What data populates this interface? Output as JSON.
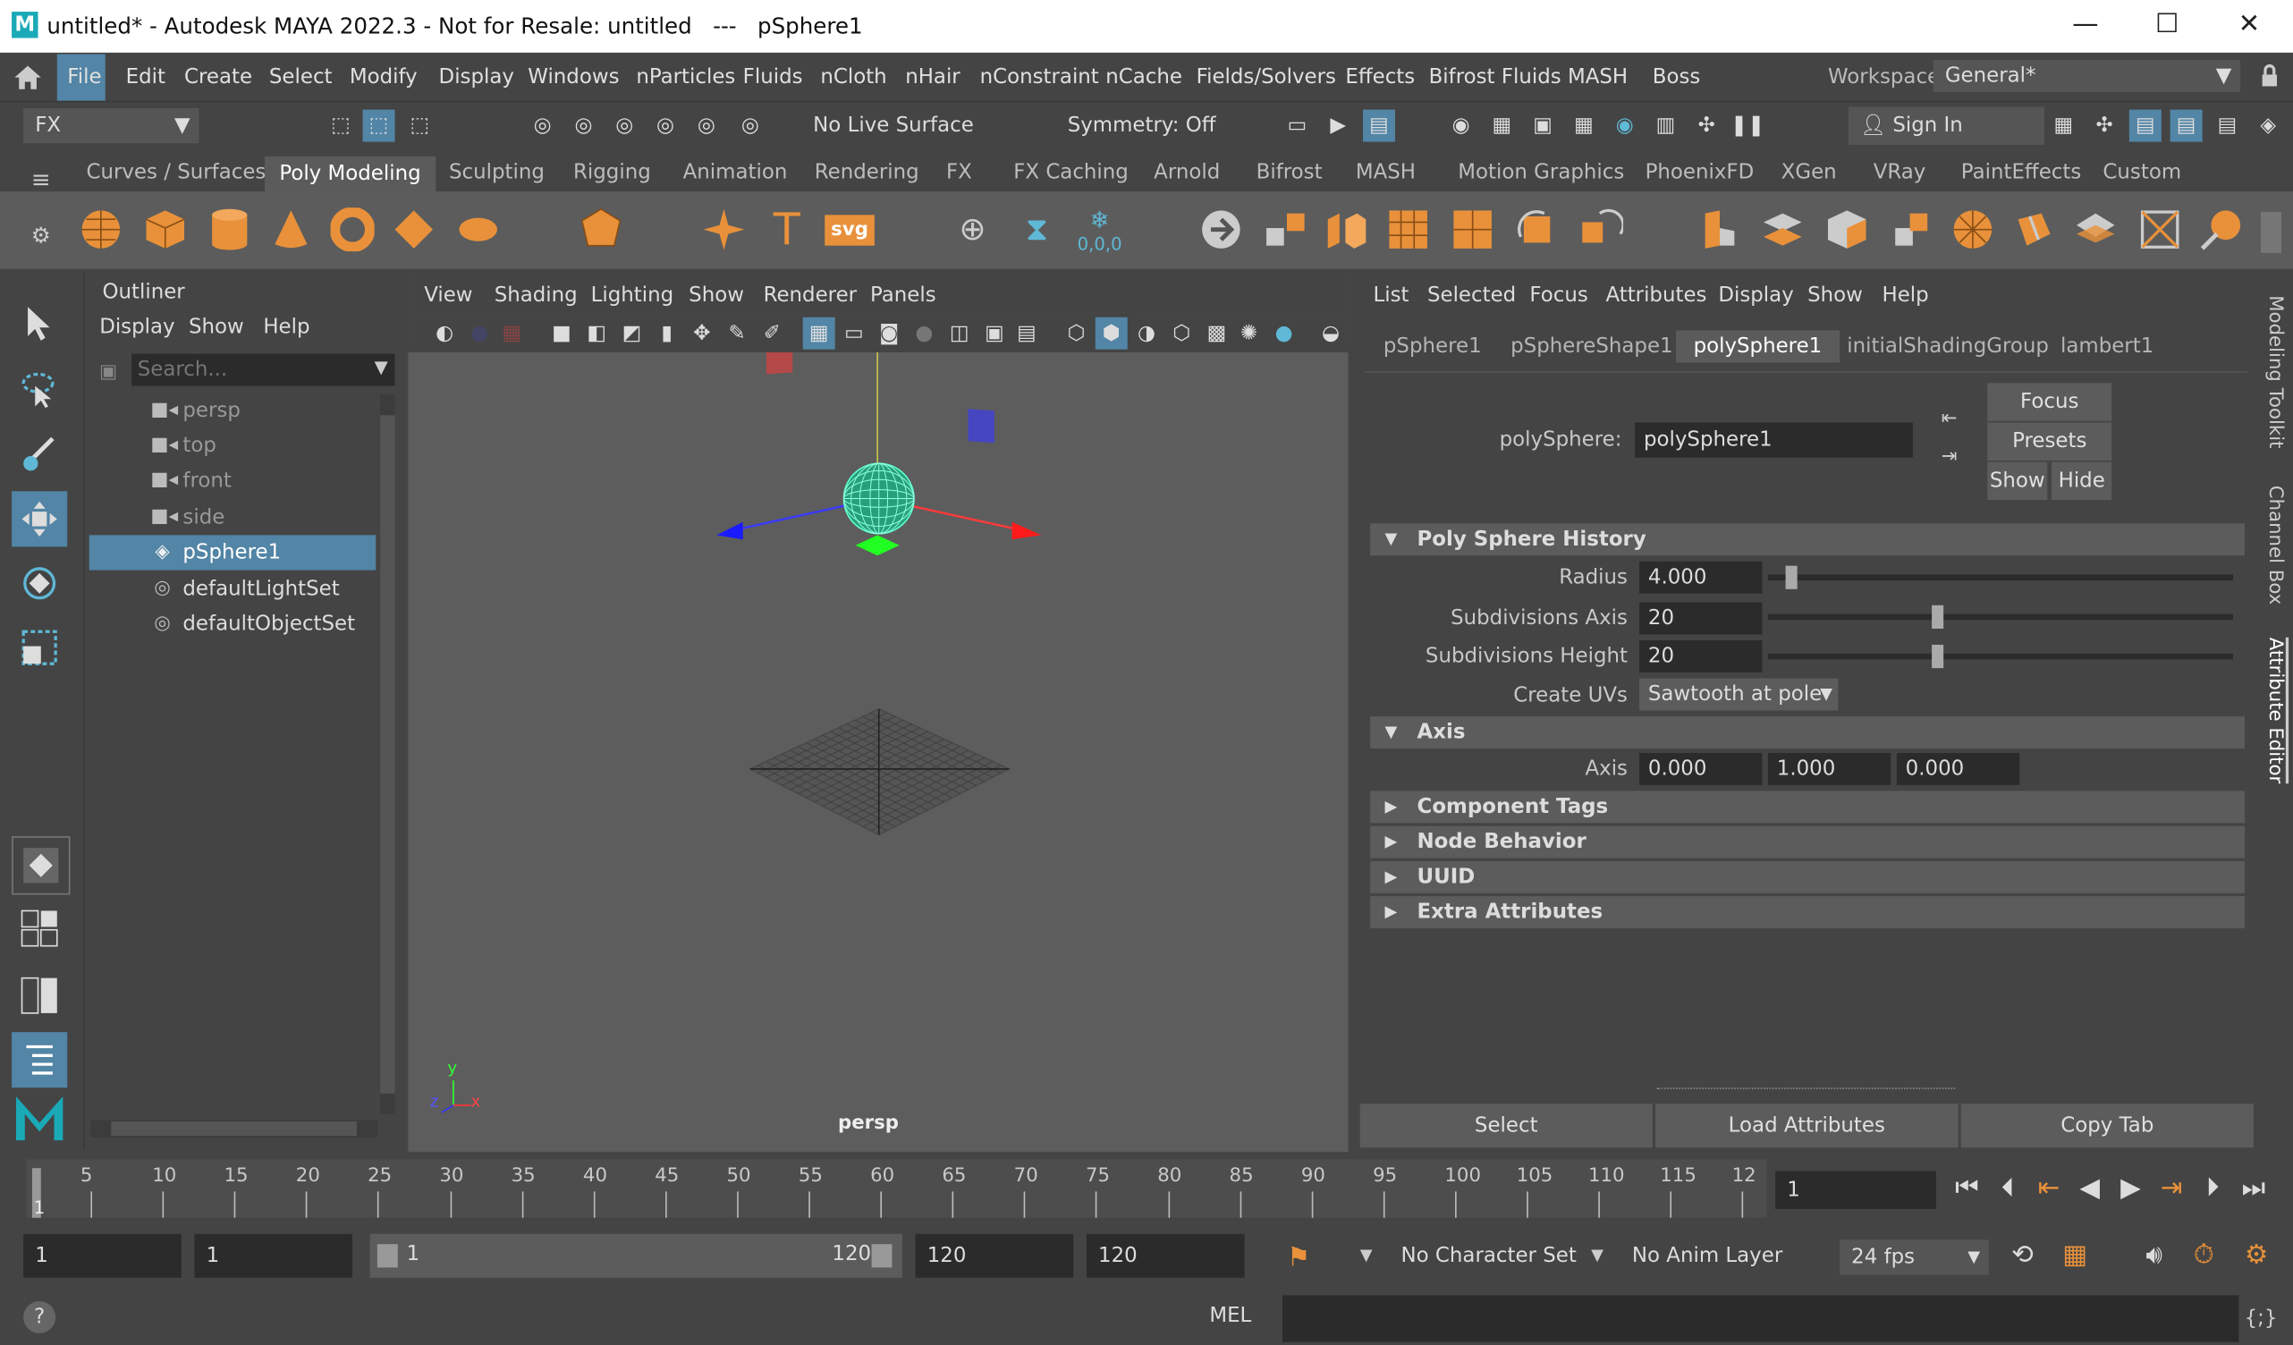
{
  "window": {
    "title": "untitled* - Autodesk MAYA 2022.3 - Not for Resale: untitled   ---   pSphere1",
    "logo": "M",
    "minimize": "—",
    "maximize": "☐",
    "close": "✕"
  },
  "menubar": {
    "items": [
      "File",
      "Edit",
      "Create",
      "Select",
      "Modify",
      "Display",
      "Windows",
      "nParticles",
      "Fluids",
      "nCloth",
      "nHair",
      "nConstraint",
      "nCache",
      "Fields/Solvers",
      "Effects",
      "Bifrost Fluids",
      "MASH",
      "Boss"
    ],
    "workspace_label": "Workspace:",
    "workspace_value": "General*"
  },
  "statusline": {
    "menuset": "FX",
    "live_surface": "No Live Surface",
    "symmetry": "Symmetry: Off",
    "sign_in": "Sign In"
  },
  "shelf": {
    "tabs": [
      "Curves / Surfaces",
      "Poly Modeling",
      "Sculpting",
      "Rigging",
      "Animation",
      "Rendering",
      "FX",
      "FX Caching",
      "Arnold",
      "Bifrost",
      "MASH",
      "Motion Graphics",
      "PhoenixFD",
      "XGen",
      "VRay",
      "PaintEffects",
      "Custom"
    ],
    "active_tab": "Poly Modeling",
    "text_icon": "T",
    "svg_icon": "svg",
    "snap_readout": "0,0,0"
  },
  "outliner": {
    "title": "Outliner",
    "menu": [
      "Display",
      "Show",
      "Help"
    ],
    "search_placeholder": "Search...",
    "items": [
      {
        "name": "persp",
        "icon": "camera-icon"
      },
      {
        "name": "top",
        "icon": "camera-icon"
      },
      {
        "name": "front",
        "icon": "camera-icon"
      },
      {
        "name": "side",
        "icon": "camera-icon"
      },
      {
        "name": "pSphere1",
        "icon": "mesh-icon"
      },
      {
        "name": "defaultLightSet",
        "icon": "set-icon"
      },
      {
        "name": "defaultObjectSet",
        "icon": "set-icon"
      }
    ],
    "selected": "pSphere1"
  },
  "viewport": {
    "menu": [
      "View",
      "Shading",
      "Lighting",
      "Show",
      "Renderer",
      "Panels"
    ],
    "camera_label": "persp",
    "axis_labels": {
      "y": "y",
      "z": "z",
      "x": "x"
    }
  },
  "attribute_editor": {
    "menu": [
      "List",
      "Selected",
      "Focus",
      "Attributes",
      "Display",
      "Show",
      "Help"
    ],
    "tabs": [
      "pSphere1",
      "pSphereShape1",
      "polySphere1",
      "initialShadingGroup",
      "lambert1"
    ],
    "active_tab": "polySphere1",
    "node_label": "polySphere:",
    "node_value": "polySphere1",
    "buttons": {
      "focus": "Focus",
      "presets": "Presets",
      "show": "Show",
      "hide": "Hide"
    },
    "sections": {
      "history": "Poly Sphere History",
      "axis": "Axis",
      "collapsed": [
        "Component Tags",
        "Node Behavior",
        "UUID",
        "Extra Attributes"
      ]
    },
    "attrs": {
      "radius_label": "Radius",
      "radius_value": "4.000",
      "radius_slider": 0.04,
      "subdiv_axis_label": "Subdivisions Axis",
      "subdiv_axis_value": "20",
      "subdiv_axis_slider": 0.36,
      "subdiv_height_label": "Subdivisions Height",
      "subdiv_height_value": "20",
      "subdiv_height_slider": 0.36,
      "create_uvs_label": "Create UVs",
      "create_uvs_value": "Sawtooth at pole",
      "axis_label": "Axis",
      "axis_x": "0.000",
      "axis_y": "1.000",
      "axis_z": "0.000"
    },
    "bottom_buttons": {
      "select": "Select",
      "load": "Load Attributes",
      "copy": "Copy Tab"
    }
  },
  "side_tabs": {
    "modeling_toolkit": "Modeling Toolkit",
    "channel_box": "Channel Box",
    "attribute_editor": "Attribute Editor"
  },
  "timeslider": {
    "ticks": [
      "5",
      "10",
      "15",
      "20",
      "25",
      "30",
      "35",
      "40",
      "45",
      "50",
      "55",
      "60",
      "65",
      "70",
      "75",
      "80",
      "85",
      "90",
      "95",
      "100",
      "105",
      "110",
      "115",
      "12"
    ],
    "start_label": "1",
    "current_frame": "1"
  },
  "rangeslider": {
    "start": "1",
    "playback_start": "1",
    "range_min": "1",
    "range_max": "120",
    "playback_end": "120",
    "end": "120",
    "character_set": "No Character Set",
    "anim_layer": "No Anim Layer",
    "fps": "24 fps"
  },
  "commandline": {
    "language": "MEL",
    "help_icon": "?"
  }
}
